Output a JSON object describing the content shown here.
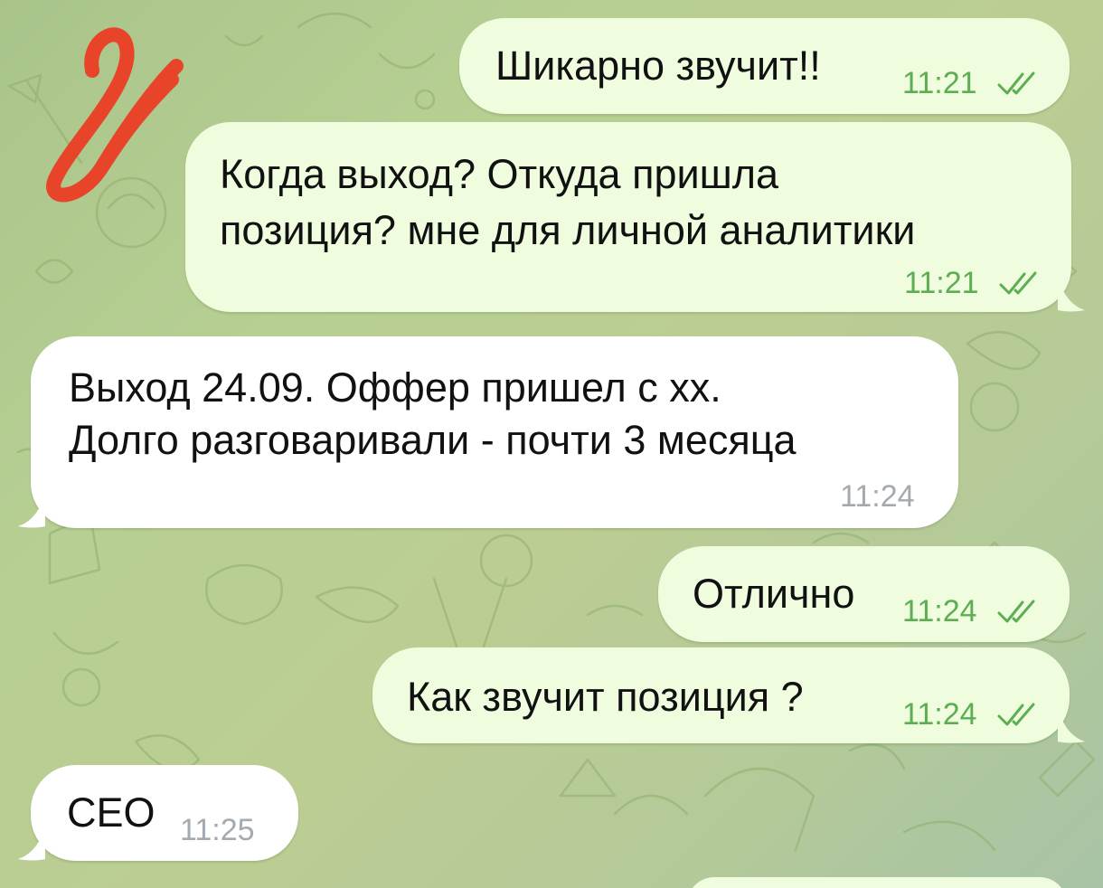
{
  "colors": {
    "outgoing_bubble": "#effdde",
    "incoming_bubble": "#ffffff",
    "outgoing_time": "#5dae53",
    "incoming_time": "#a3aab0",
    "read_ticks": "#5dae53",
    "mark": "#e8442a"
  },
  "messages": [
    {
      "direction": "outgoing",
      "lines": [
        "Шикарно звучит!!"
      ],
      "time": "11:21",
      "status_icon": "double-check-icon"
    },
    {
      "direction": "outgoing",
      "lines": [
        "Когда выход? Откуда пришла",
        "позиция? мне для личной аналитики"
      ],
      "time": "11:21",
      "status_icon": "double-check-icon"
    },
    {
      "direction": "incoming",
      "lines": [
        "Выход 24.09. Оффер пришел с хх.",
        "Долго разговаривали - почти 3 месяца"
      ],
      "time": "11:24"
    },
    {
      "direction": "outgoing",
      "lines": [
        "Отлично"
      ],
      "time": "11:24",
      "status_icon": "double-check-icon"
    },
    {
      "direction": "outgoing",
      "lines": [
        "Как звучит позиция ?"
      ],
      "time": "11:24",
      "status_icon": "double-check-icon"
    },
    {
      "direction": "incoming",
      "lines": [
        "CEO"
      ],
      "time": "11:25"
    }
  ]
}
